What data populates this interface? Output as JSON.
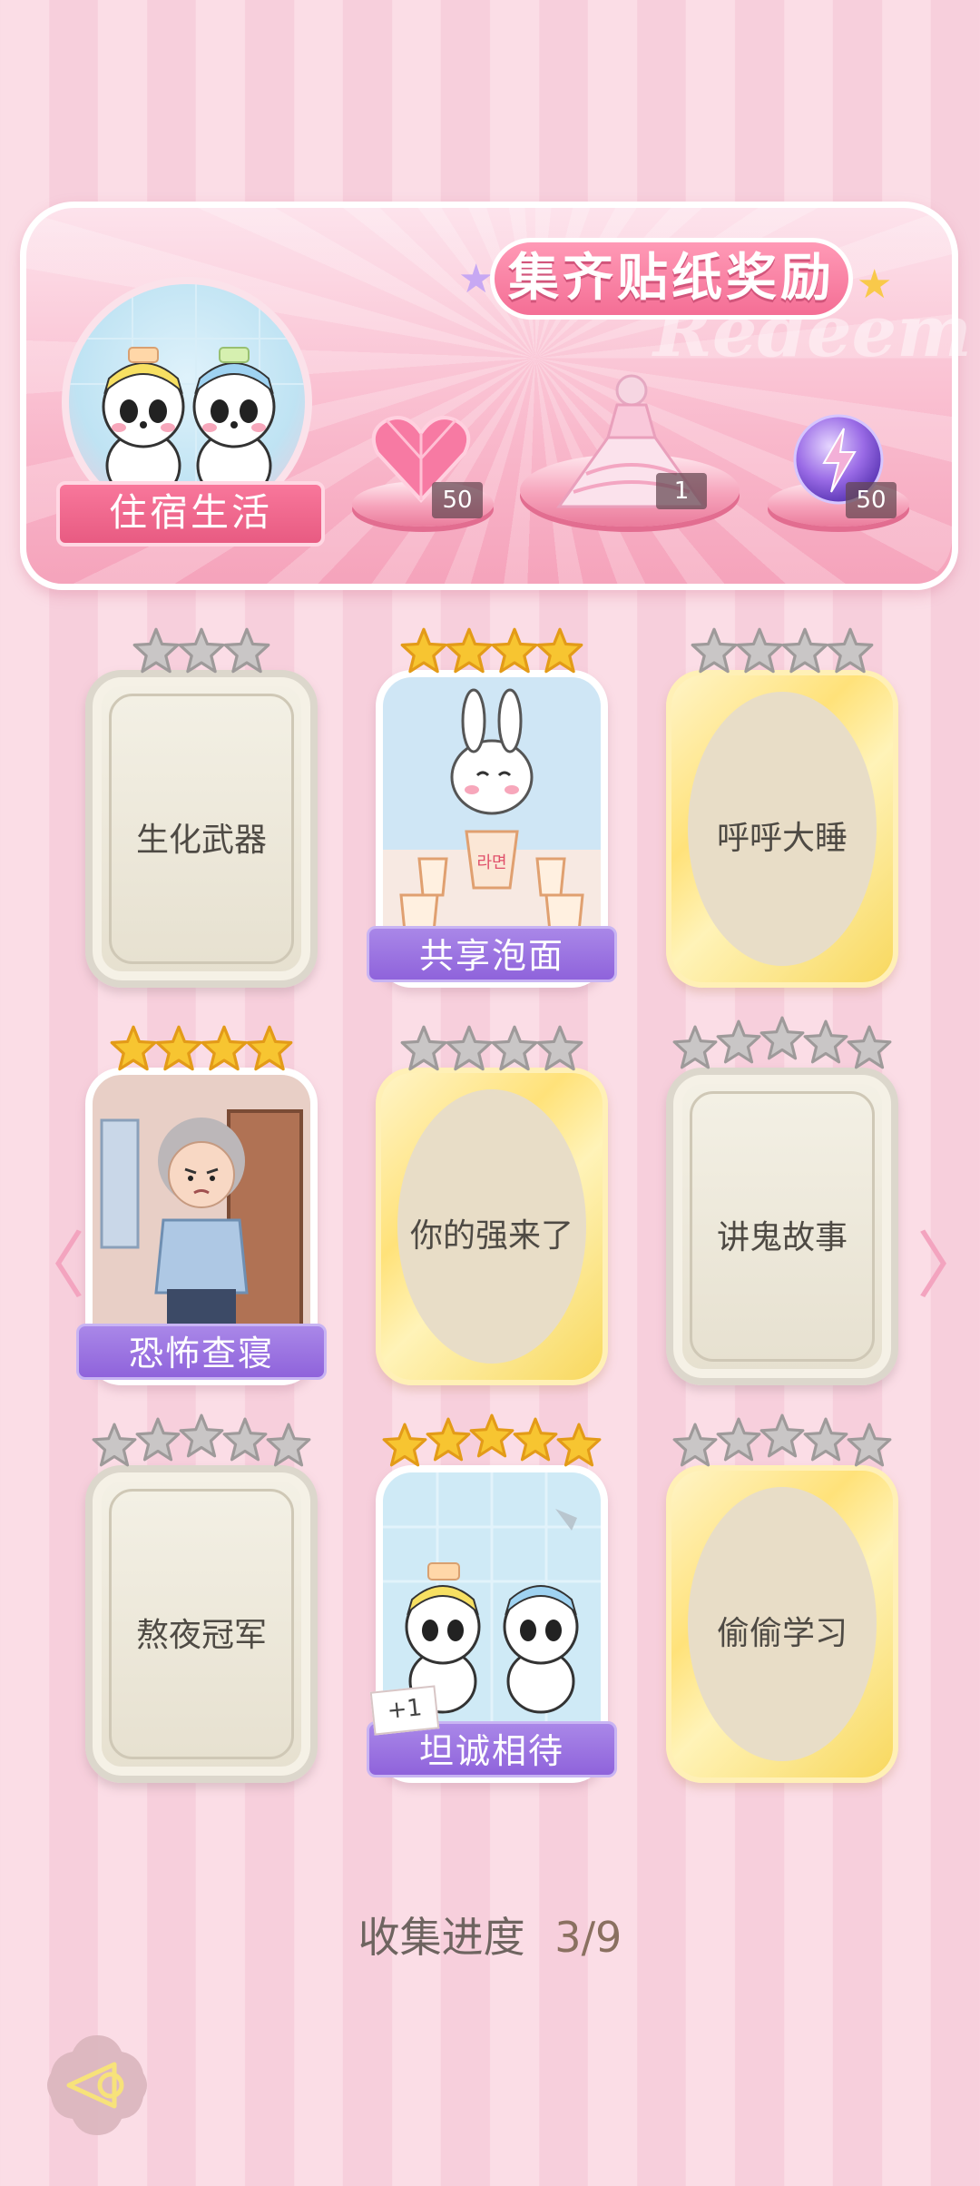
{
  "banner": {
    "title": "集齐贴纸奖励",
    "watermark": "Redeem",
    "tag": "住宿生活",
    "rewards": [
      {
        "icon": "heart-gem-icon",
        "count": "50"
      },
      {
        "icon": "dress-icon",
        "count": "1"
      },
      {
        "icon": "energy-orb-icon",
        "count": "50"
      }
    ]
  },
  "cards": [
    {
      "label": "生化武器",
      "style": "frame",
      "stars": 3,
      "collected": false
    },
    {
      "label": "共享泡面",
      "style": "image",
      "stars": 4,
      "collected": true
    },
    {
      "label": "呼呼大睡",
      "style": "oval",
      "stars": 4,
      "collected": false
    },
    {
      "label": "恐怖查寝",
      "style": "image",
      "stars": 4,
      "collected": true
    },
    {
      "label": "你的强来了",
      "style": "oval",
      "stars": 4,
      "collected": false
    },
    {
      "label": "讲鬼故事",
      "style": "frame",
      "stars": 5,
      "collected": false
    },
    {
      "label": "熬夜冠军",
      "style": "frame",
      "stars": 5,
      "collected": false
    },
    {
      "label": "坦诚相待",
      "style": "image",
      "stars": 5,
      "collected": true,
      "extra_badge": "+1"
    },
    {
      "label": "偷偷学习",
      "style": "oval",
      "stars": 5,
      "collected": false
    }
  ],
  "progress": {
    "label": "收集进度",
    "value": "3/9"
  },
  "nav": {
    "prev": "〈",
    "next": "〉"
  },
  "colors": {
    "accent": "#f46e95",
    "gold_star": "#f7c531",
    "gray_star": "#c9c6c6",
    "plate": "#8f63db"
  }
}
